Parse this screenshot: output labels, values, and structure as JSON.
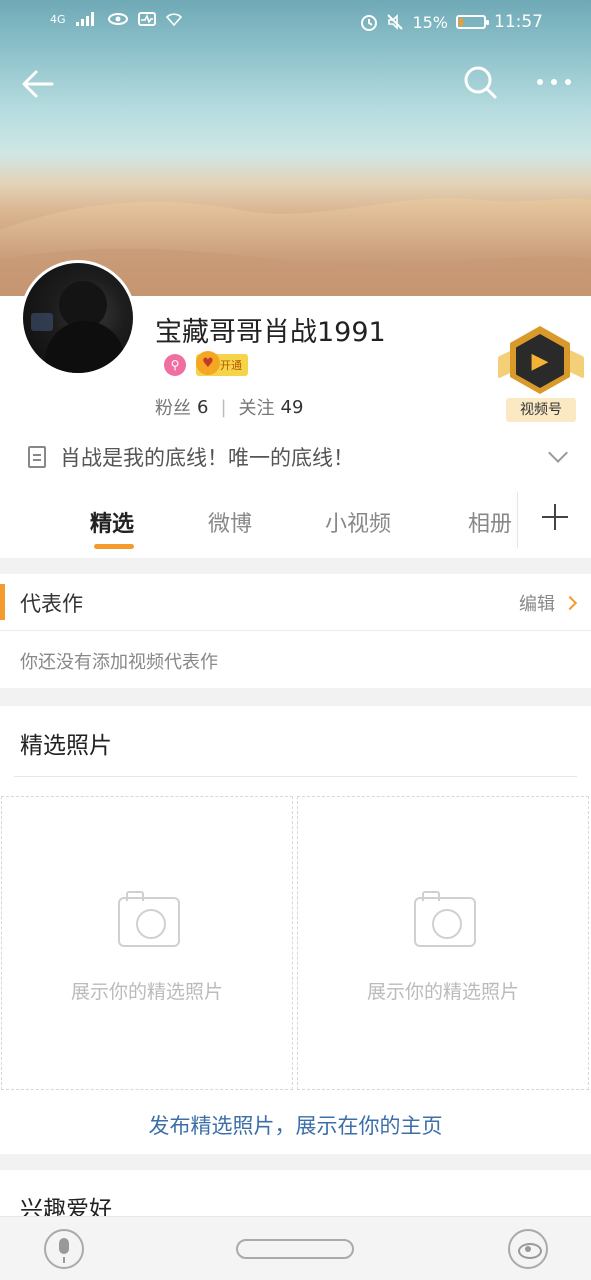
{
  "status_bar": {
    "network": "4G",
    "battery_percent": "15%",
    "time": "11:57"
  },
  "profile": {
    "name": "宝藏哥哥肖战1991",
    "vip_badge": "开通",
    "fans_label": "粉丝",
    "fans_count": "6",
    "following_label": "关注",
    "following_count": "49",
    "video_badge_label": "视频号",
    "bio": "肖战是我的底线！唯一的底线！"
  },
  "tabs": [
    {
      "label": "精选"
    },
    {
      "label": "微博"
    },
    {
      "label": "小视频"
    },
    {
      "label": "相册"
    }
  ],
  "works": {
    "title": "代表作",
    "edit_label": "编辑",
    "empty_text": "你还没有添加视频代表作"
  },
  "photos": {
    "title": "精选照片",
    "slot_caption": "展示你的精选照片",
    "publish_link": "发布精选照片，展示在你的主页"
  },
  "interests": {
    "title": "兴趣爱好"
  },
  "colors": {
    "accent": "#f39b2c",
    "link": "#3c6fa8"
  }
}
